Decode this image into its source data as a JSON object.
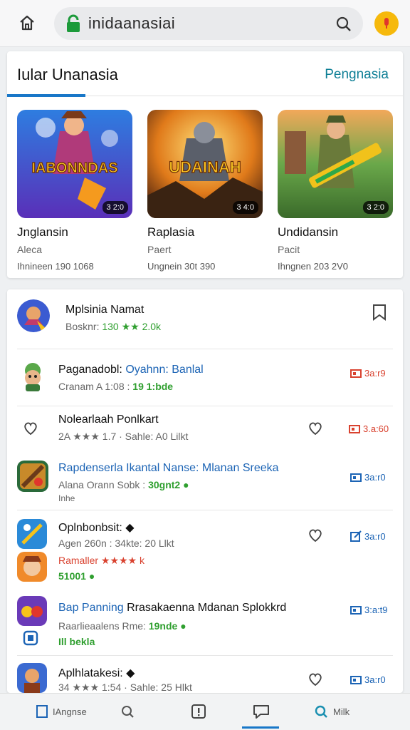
{
  "browser": {
    "url": "inidaanasiai",
    "icons": [
      "home-icon",
      "lock-icon",
      "search-icon",
      "mic-icon"
    ]
  },
  "featured": {
    "title": "Iular Unanasia",
    "link": "Pengnasia",
    "games": [
      {
        "name": "Jnglansin",
        "sub": "Aleca",
        "meta": "Ihnineen 190 1068",
        "badge": "3 2:0",
        "art_text": "IABONNDAS"
      },
      {
        "name": "Raplasia",
        "sub": "Paert",
        "meta": "Ungnein 30t 390",
        "badge": "3 4:0",
        "art_text": "UDAINAH"
      },
      {
        "name": "Undidansin",
        "sub": "Pacit",
        "meta": "Ihngnen 203 2V0",
        "badge": "3 2:0",
        "art_text": ""
      }
    ]
  },
  "list": {
    "header": {
      "title": "Mplsinia Namat",
      "sub_prefix": "Bosknr: ",
      "sub_green": "130 ★★ 2.0k"
    },
    "items": [
      {
        "title_a": "Paganadobl: ",
        "title_b": "Oyahnn: Banlal",
        "sub_a": "Cranam A 1:08 : ",
        "sub_b": "19 1:bde",
        "badge": "3a:r9",
        "badge_color": "red"
      },
      {
        "title_a": "Nolearlaah Ponlkart",
        "title_b": "",
        "sub_a": "2A ★★★ 1.7 · Sahle: A0 Lilkt",
        "sub_b": "",
        "badge": "3.a:60",
        "badge_color": "red"
      },
      {
        "title_a": "Rapdenserla Ikantal Nanse: Mlanan Sreeka",
        "title_b": "",
        "sub_a": "Alana Orann Sobk : ",
        "sub_b": "30gnt2",
        "sub_c": "Inhe",
        "badge": "3a:r0",
        "badge_color": "blue"
      },
      {
        "title_a": "Oplnbonbsit: ",
        "title_b": "",
        "sub_a": "Agen 260n : 34kte: 20 Llkt",
        "sub_b": "",
        "extra_a": "Ramaller ★★★★ k",
        "extra_b": "51001",
        "badge": "3a:r0",
        "badge_color": "blue"
      },
      {
        "title_a": "Bap Panning ",
        "title_b": "Rrasakaenna Mdanan Splokkrd",
        "sub_a": "Raarlieaalens Rme: ",
        "sub_b": "19nde",
        "sub_c": "Ill bekla",
        "badge": "3:a:t9",
        "badge_color": "blue"
      },
      {
        "title_a": "Aplhlatakesi: ",
        "title_b": "",
        "sub_a": "34 ★★★ 1:54 · Sahle: 25 Hlkt",
        "sub_b": "",
        "badge": "3a:r0",
        "badge_color": "blue"
      }
    ]
  },
  "nav": {
    "items": [
      {
        "label": "IAngnse",
        "icon": "page-icon"
      },
      {
        "label": "",
        "icon": "search-icon"
      },
      {
        "label": "",
        "icon": "info-icon"
      },
      {
        "label": "",
        "icon": "chat-icon"
      },
      {
        "label": "Milk",
        "icon": "search-icon"
      }
    ]
  },
  "colors": {
    "accent": "#1877c8",
    "link": "#0e7f96",
    "green": "#2f9f2f",
    "red": "#d9422f",
    "star": "#f3b21b"
  }
}
